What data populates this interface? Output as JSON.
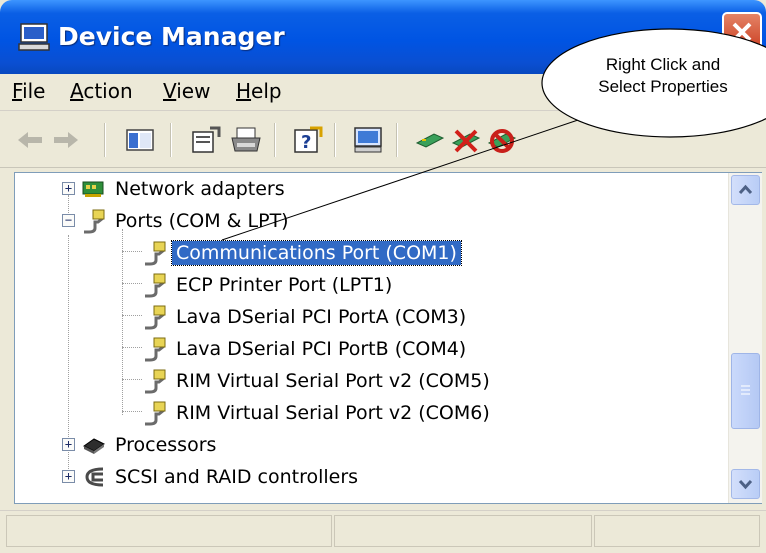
{
  "window": {
    "title": "Device Manager",
    "title_icon": "computer-monitor-icon",
    "close_icon": "close-icon"
  },
  "menu": {
    "items": [
      {
        "label": "File",
        "accel": "F",
        "rest": "ile"
      },
      {
        "label": "Action",
        "accel": "A",
        "rest": "ction"
      },
      {
        "label": "View",
        "accel": "V",
        "rest": "iew"
      },
      {
        "label": "Help",
        "accel": "H",
        "rest": "elp"
      }
    ]
  },
  "toolbar": {
    "buttons": [
      "back-arrow-icon",
      "forward-arrow-icon",
      "show-hide-console-tree-icon",
      "properties-icon",
      "print-icon",
      "help-icon",
      "scan-hardware-icon",
      "update-driver-icon",
      "uninstall-icon",
      "disable-icon"
    ]
  },
  "tree": {
    "items": [
      {
        "label": "Network adapters",
        "icon": "network-card-icon",
        "expander": "+"
      },
      {
        "label": "Ports (COM & LPT)",
        "icon": "port-plug-icon",
        "expander": "−"
      },
      {
        "label": "Communications Port (COM1)",
        "icon": "port-plug-icon",
        "selected": true
      },
      {
        "label": "ECP Printer Port (LPT1)",
        "icon": "port-plug-icon"
      },
      {
        "label": "Lava DSerial PCI PortA (COM3)",
        "icon": "port-plug-icon"
      },
      {
        "label": "Lava DSerial PCI PortB (COM4)",
        "icon": "port-plug-icon"
      },
      {
        "label": "RIM Virtual Serial Port v2 (COM5)",
        "icon": "port-plug-icon"
      },
      {
        "label": "RIM Virtual Serial Port v2 (COM6)",
        "icon": "port-plug-icon"
      },
      {
        "label": "Processors",
        "icon": "processor-chip-icon",
        "expander": "+"
      },
      {
        "label": "SCSI and RAID controllers",
        "icon": "scsi-controller-icon",
        "expander": "+"
      }
    ]
  },
  "callout": {
    "line1": "Right Click and",
    "line2": "Select Properties"
  },
  "colors": {
    "titlebar": "#0054e3",
    "selection": "#316ac5",
    "window_bg": "#ece9d8"
  }
}
